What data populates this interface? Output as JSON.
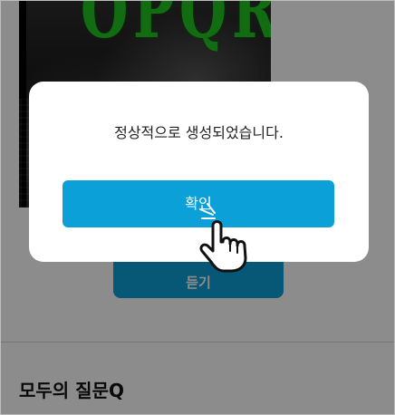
{
  "poster": {
    "title_text": "OPQR"
  },
  "background_button": {
    "label": "듣기"
  },
  "section": {
    "title": "모두의 질문Q"
  },
  "dialog": {
    "message": "정상적으로 생성되었습니다.",
    "confirm_label": "확인"
  },
  "icons": {
    "pointer": "pointing-hand-icon"
  },
  "colors": {
    "accent": "#0ba1d8",
    "poster_title": "#22c722",
    "overlay": "rgba(0,0,0,0.45)"
  }
}
